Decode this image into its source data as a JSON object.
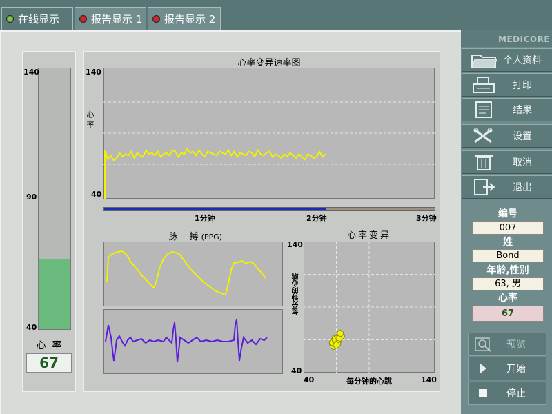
{
  "tabs": [
    {
      "label": "在线显示",
      "dot_color": "#7ec24a"
    },
    {
      "label": "报告显示 1",
      "dot_color": "#c82a2a"
    },
    {
      "label": "报告显示 2",
      "dot_color": "#c82a2a"
    }
  ],
  "brand": "MEDICORE",
  "hr_gauge": {
    "label": "心  率",
    "value": "67",
    "hr": 67,
    "ticks": [
      "140",
      "90",
      "40"
    ],
    "range": [
      40,
      140
    ],
    "fill_color": "#6cbb7e"
  },
  "hrv_speed": {
    "title": "心率变异速率图",
    "ylabel": "心  率",
    "ytop": "140",
    "ybottom": "40",
    "time_labels": [
      "1分钟",
      "2分钟",
      "3分钟"
    ],
    "progress": 0.67
  },
  "ppg": {
    "title": "脉    搏",
    "unit": "(PPG)"
  },
  "hrv_scatter": {
    "title": "心率变异",
    "xlabel": "每分钟的心跳",
    "ylabel": "每分钟的心跳",
    "xmin": "40",
    "xmax": "140",
    "ytop": "140",
    "ybottom": "40"
  },
  "chart_data": [
    {
      "type": "line",
      "title": "心率变异速率图",
      "xlabel": "",
      "ylabel": "心 率",
      "ylim": [
        40,
        140
      ],
      "x_ticks": [
        "1分钟",
        "2分钟",
        "3分钟"
      ],
      "xlim": [
        0,
        3
      ],
      "series": [
        {
          "values": [
            77,
            70,
            73,
            69,
            71,
            75,
            72,
            74,
            73,
            76,
            71,
            75,
            73,
            72,
            77,
            74,
            75,
            73,
            76,
            72,
            74,
            75,
            73,
            77,
            76,
            72,
            75,
            74,
            78,
            75,
            76,
            73,
            77,
            74,
            72,
            76,
            75,
            74,
            73,
            76,
            75,
            74,
            77,
            73,
            76,
            72,
            75,
            74,
            73,
            76,
            75,
            72,
            77,
            74,
            73,
            75,
            76,
            72,
            74,
            73,
            71,
            74,
            72,
            75,
            73,
            71,
            74,
            72,
            70,
            74,
            73,
            71,
            72,
            76,
            72,
            74
          ]
        }
      ]
    },
    {
      "type": "scatter",
      "title": "心率变异",
      "xlabel": "每分钟的心跳",
      "ylabel": "每分钟的心跳",
      "xlim": [
        40,
        140
      ],
      "ylim": [
        40,
        140
      ],
      "points": [
        [
          62,
          62
        ],
        [
          63,
          64
        ],
        [
          64,
          66
        ],
        [
          65,
          65
        ],
        [
          66,
          67
        ],
        [
          67,
          68
        ],
        [
          68,
          67
        ],
        [
          66,
          63
        ],
        [
          64,
          61
        ],
        [
          65,
          63
        ],
        [
          67,
          65
        ],
        [
          68,
          69
        ],
        [
          69,
          68
        ],
        [
          63,
          60
        ],
        [
          62,
          63
        ],
        [
          65,
          66
        ],
        [
          66,
          64
        ],
        [
          64,
          65
        ],
        [
          67,
          66
        ],
        [
          68,
          70
        ],
        [
          66,
          62
        ],
        [
          65,
          61
        ]
      ]
    }
  ],
  "sidebar": {
    "menu": [
      {
        "label": "个人资料",
        "icon": "folder-icon"
      },
      {
        "label": "打印",
        "icon": "printer-icon"
      },
      {
        "label": "结果",
        "icon": "document-icon"
      },
      {
        "label": "设置",
        "icon": "tools-icon"
      },
      {
        "label": "取消",
        "icon": "trash-icon"
      },
      {
        "label": "退出",
        "icon": "exit-icon"
      }
    ],
    "info": {
      "id_label": "编号",
      "id_value": "007",
      "name_label": "姓",
      "name_value": "Bond",
      "age_label": "年龄,性别",
      "age_value": "63, 男",
      "hr_label": "心率",
      "hr_value": "67"
    },
    "actions": [
      {
        "label": "预览",
        "icon": "preview-icon"
      },
      {
        "label": "开始",
        "icon": "play-icon"
      },
      {
        "label": "停止",
        "icon": "stop-icon"
      }
    ]
  }
}
